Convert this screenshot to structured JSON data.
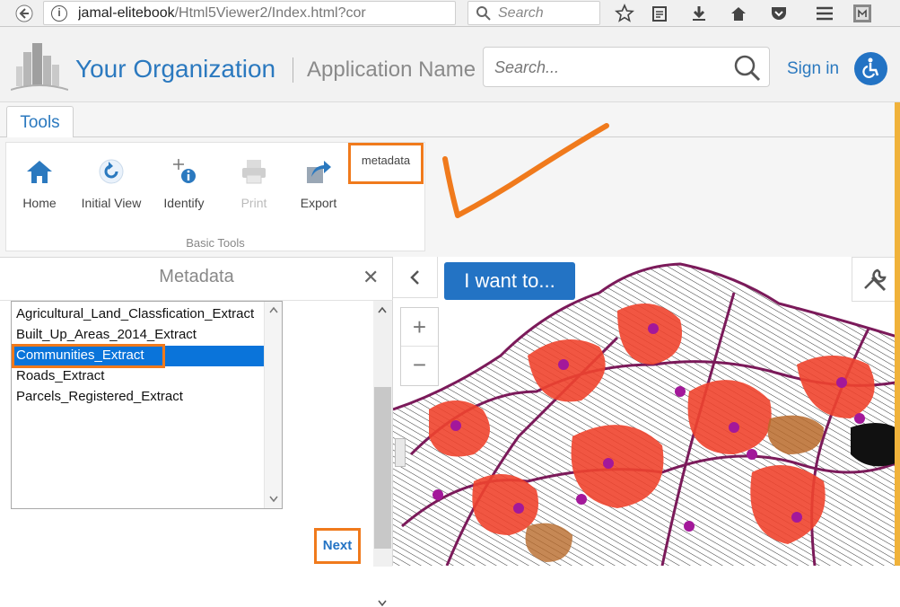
{
  "browser": {
    "url_host": "jamal-elitebook",
    "url_path": "/Html5Viewer2/Index.html?cor",
    "search_placeholder": "Search"
  },
  "header": {
    "org_name": "Your Organization",
    "app_name": "Application Name",
    "search_placeholder": "Search...",
    "sign_in": "Sign in"
  },
  "ribbon": {
    "tab_label": "Tools",
    "buttons": [
      {
        "label": "Home",
        "icon": "home-icon"
      },
      {
        "label": "Initial View",
        "icon": "refresh-icon"
      },
      {
        "label": "Identify",
        "icon": "identify-icon"
      },
      {
        "label": "Print",
        "icon": "printer-icon",
        "disabled": true
      },
      {
        "label": "Export",
        "icon": "export-icon"
      }
    ],
    "metadata_label": "metadata",
    "group_label": "Basic Tools"
  },
  "panel": {
    "title": "Metadata",
    "layers": [
      "Agricultural_Land_Classfication_Extract",
      "Built_Up_Areas_2014_Extract",
      "Communities_Extract",
      "Roads_Extract",
      "Parcels_Registered_Extract"
    ],
    "selected_index": 2,
    "next_label": "Next"
  },
  "map": {
    "i_want_to": "I want to...",
    "zoom_in": "+",
    "zoom_out": "−"
  },
  "colors": {
    "brand_blue": "#2b79bf",
    "button_blue": "#2373c4",
    "highlight_orange": "#f07a1c",
    "selection_blue": "#0a74da"
  }
}
